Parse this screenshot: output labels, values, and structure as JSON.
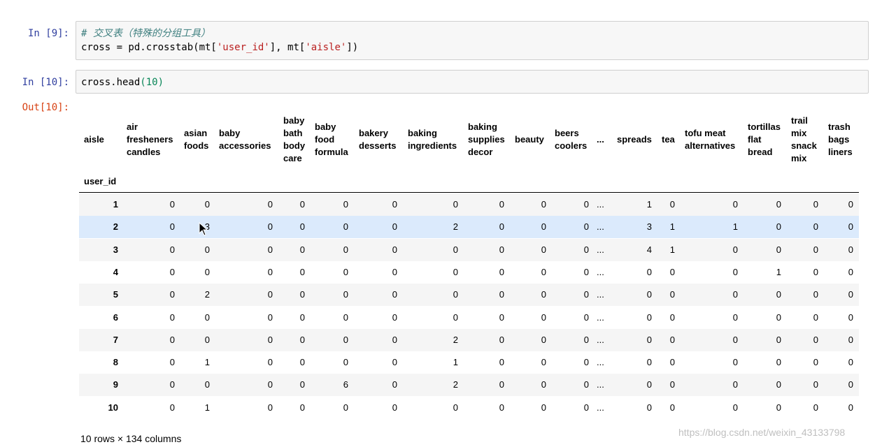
{
  "cells": [
    {
      "prompt": "In [9]:",
      "lines": [
        [
          {
            "t": "# 交叉表（特殊的分组工具）",
            "c": "cm-comment"
          }
        ],
        [
          {
            "t": "cross = pd.crosstab(mt[",
            "c": ""
          },
          {
            "t": "'user_id'",
            "c": "cm-string"
          },
          {
            "t": "], mt[",
            "c": ""
          },
          {
            "t": "'aisle'",
            "c": "cm-string"
          },
          {
            "t": "])",
            "c": ""
          }
        ]
      ]
    },
    {
      "prompt": "In [10]:",
      "lines": [
        [
          {
            "t": "cross.head",
            "c": ""
          },
          {
            "t": "(",
            "c": "cm-paren"
          },
          {
            "t": "10",
            "c": "cm-num"
          },
          {
            "t": ")",
            "c": "cm-paren"
          }
        ]
      ]
    }
  ],
  "out_prompt": "Out[10]:",
  "table": {
    "columns_name": "aisle",
    "index_name": "user_id",
    "columns": [
      [
        "air",
        "fresheners",
        "candles"
      ],
      [
        "asian",
        "foods"
      ],
      [
        "baby",
        "accessories"
      ],
      [
        "baby",
        "bath",
        "body",
        "care"
      ],
      [
        "baby",
        "food",
        "formula"
      ],
      [
        "bakery",
        "desserts"
      ],
      [
        "baking",
        "ingredients"
      ],
      [
        "baking",
        "supplies",
        "decor"
      ],
      [
        "beauty"
      ],
      [
        "beers",
        "coolers"
      ],
      [
        "..."
      ],
      [
        "spreads"
      ],
      [
        "tea"
      ],
      [
        "tofu meat",
        "alternatives"
      ],
      [
        "tortillas",
        "flat",
        "bread"
      ],
      [
        "trail",
        "mix",
        "snack",
        "mix"
      ],
      [
        "trash",
        "bags",
        "liners"
      ]
    ],
    "rows": [
      {
        "index": "1",
        "values": [
          "0",
          "0",
          "0",
          "0",
          "0",
          "0",
          "0",
          "0",
          "0",
          "0",
          "...",
          "1",
          "0",
          "0",
          "0",
          "0",
          "0"
        ]
      },
      {
        "index": "2",
        "values": [
          "0",
          "3",
          "0",
          "0",
          "0",
          "0",
          "2",
          "0",
          "0",
          "0",
          "...",
          "3",
          "1",
          "1",
          "0",
          "0",
          "0"
        ]
      },
      {
        "index": "3",
        "values": [
          "0",
          "0",
          "0",
          "0",
          "0",
          "0",
          "0",
          "0",
          "0",
          "0",
          "...",
          "4",
          "1",
          "0",
          "0",
          "0",
          "0"
        ]
      },
      {
        "index": "4",
        "values": [
          "0",
          "0",
          "0",
          "0",
          "0",
          "0",
          "0",
          "0",
          "0",
          "0",
          "...",
          "0",
          "0",
          "0",
          "1",
          "0",
          "0"
        ]
      },
      {
        "index": "5",
        "values": [
          "0",
          "2",
          "0",
          "0",
          "0",
          "0",
          "0",
          "0",
          "0",
          "0",
          "...",
          "0",
          "0",
          "0",
          "0",
          "0",
          "0"
        ]
      },
      {
        "index": "6",
        "values": [
          "0",
          "0",
          "0",
          "0",
          "0",
          "0",
          "0",
          "0",
          "0",
          "0",
          "...",
          "0",
          "0",
          "0",
          "0",
          "0",
          "0"
        ]
      },
      {
        "index": "7",
        "values": [
          "0",
          "0",
          "0",
          "0",
          "0",
          "0",
          "2",
          "0",
          "0",
          "0",
          "...",
          "0",
          "0",
          "0",
          "0",
          "0",
          "0"
        ]
      },
      {
        "index": "8",
        "values": [
          "0",
          "1",
          "0",
          "0",
          "0",
          "0",
          "1",
          "0",
          "0",
          "0",
          "...",
          "0",
          "0",
          "0",
          "0",
          "0",
          "0"
        ]
      },
      {
        "index": "9",
        "values": [
          "0",
          "0",
          "0",
          "0",
          "6",
          "0",
          "2",
          "0",
          "0",
          "0",
          "...",
          "0",
          "0",
          "0",
          "0",
          "0",
          "0"
        ]
      },
      {
        "index": "10",
        "values": [
          "0",
          "1",
          "0",
          "0",
          "0",
          "0",
          "0",
          "0",
          "0",
          "0",
          "...",
          "0",
          "0",
          "0",
          "0",
          "0",
          "0"
        ]
      }
    ],
    "hovered_row": 1,
    "footer": "10 rows × 134 columns"
  },
  "watermark": "https://blog.csdn.net/weixin_43133798"
}
